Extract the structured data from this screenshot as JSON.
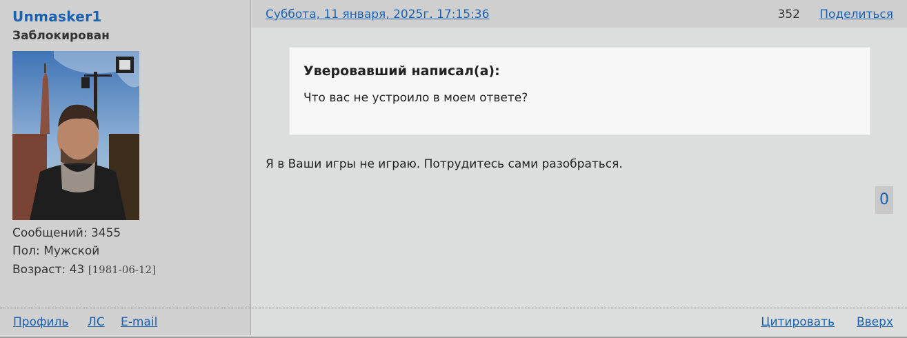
{
  "user": {
    "name": "Unmasker1",
    "status": "Заблокирован",
    "posts_label": "Сообщений:",
    "posts_count": "3455",
    "gender_label": "Пол:",
    "gender": "Мужской",
    "age_label": "Возраст:",
    "age": "43",
    "birthdate": "[1981-06-12]",
    "links": {
      "profile": "Профиль",
      "pm": "ЛС",
      "email": "E-mail"
    }
  },
  "post": {
    "date": "Суббота, 11 января, 2025г. 17:15:36",
    "number": "352",
    "share_label": "Поделиться",
    "quote": {
      "author": "Уверовавший написал(а):",
      "text": "Что вас не устроило в моем ответе?"
    },
    "text": "Я в Ваши игры не играю. Потрудитесь сами разобраться.",
    "rating": "0",
    "actions": {
      "quote": "Цитировать",
      "top": "Вверх"
    }
  },
  "colors": {
    "link": "#1a62b0",
    "left_bg": "#d0d0d0",
    "main_bg": "#dcdedd",
    "header_bg": "#cfcfcf",
    "quote_bg": "#f7f7f7"
  },
  "icons": {
    "avatar": "user-avatar-photo"
  }
}
